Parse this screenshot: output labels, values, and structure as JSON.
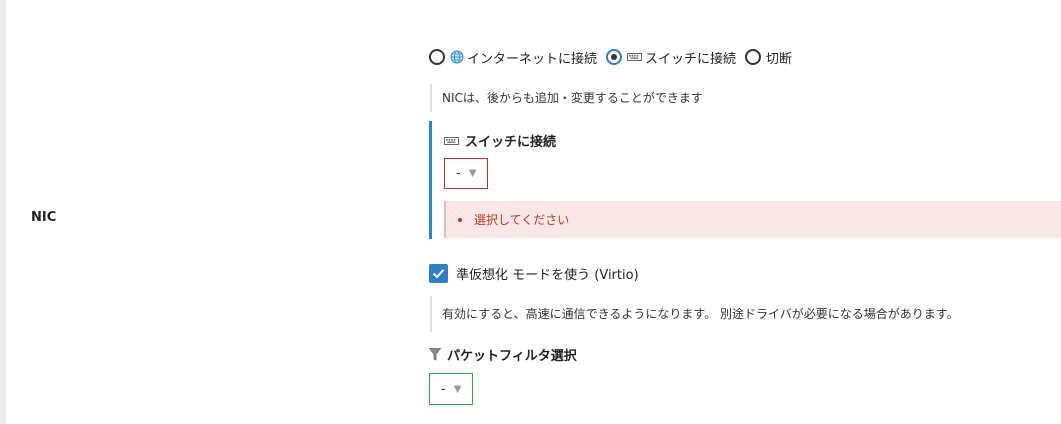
{
  "field": {
    "label": "NIC"
  },
  "connection": {
    "options": [
      {
        "label": "インターネットに接続",
        "icon": "globe-icon",
        "selected": false
      },
      {
        "label": "スイッチに接続",
        "icon": "switch-icon",
        "selected": true
      },
      {
        "label": "切断",
        "icon": "",
        "selected": false
      }
    ],
    "help": "NICは、後からも追加・変更することができます"
  },
  "switch_section": {
    "title": "スイッチに接続",
    "icon": "switch-icon",
    "selected_value": "-",
    "error": "選択してください",
    "accent_color": "#2b88c7",
    "error_color": "#c62b2b"
  },
  "virtio": {
    "label": "準仮想化 モードを使う (Virtio)",
    "checked": true,
    "help": "有効にすると、高速に通信できるようになります。 別途ドライバが必要になる場合があります。"
  },
  "packet_filter": {
    "title": "パケットフィルタ選択",
    "icon": "filter-icon",
    "selected_value": "-",
    "accent_color": "#3aa845"
  }
}
